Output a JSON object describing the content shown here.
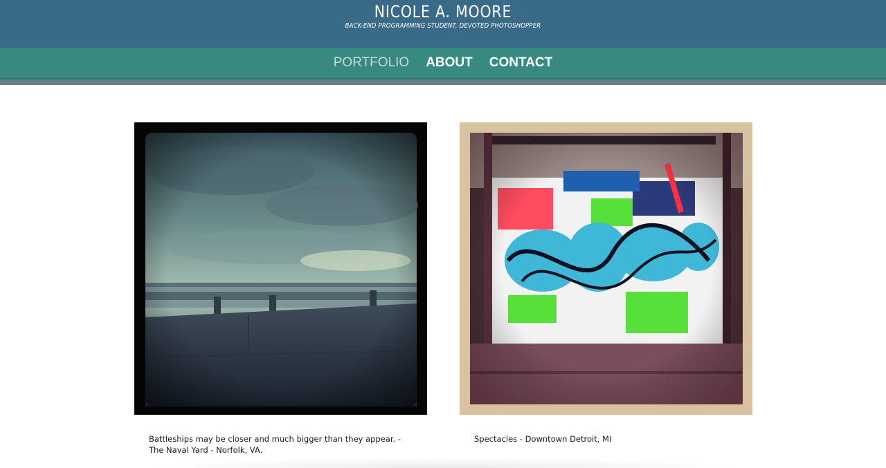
{
  "header": {
    "title": "NICOLE A. MOORE",
    "tagline": "BACK-END PROGRAMMING STUDENT, DEVOTED PHOTOSHOPPER"
  },
  "nav": {
    "items": [
      {
        "label": "PORTFOLIO",
        "active": true
      },
      {
        "label": "ABOUT",
        "active": false
      },
      {
        "label": "CONTACT",
        "active": false
      }
    ]
  },
  "gallery": {
    "photos": [
      {
        "subject": "cloudy-sky-over-water-with-railing",
        "caption": "Battleships may be closer and much bigger than they appear. - The Naval Yard - Norfolk, VA."
      },
      {
        "subject": "spectacles-graffiti-mural",
        "caption": "Spectacles - Downtown Detroit, MI"
      }
    ]
  },
  "colors": {
    "header_bg": "#396a88",
    "nav_bg": "#378a80",
    "nav_active": "#c9d8d6",
    "stripe": "#6b7f8a"
  }
}
